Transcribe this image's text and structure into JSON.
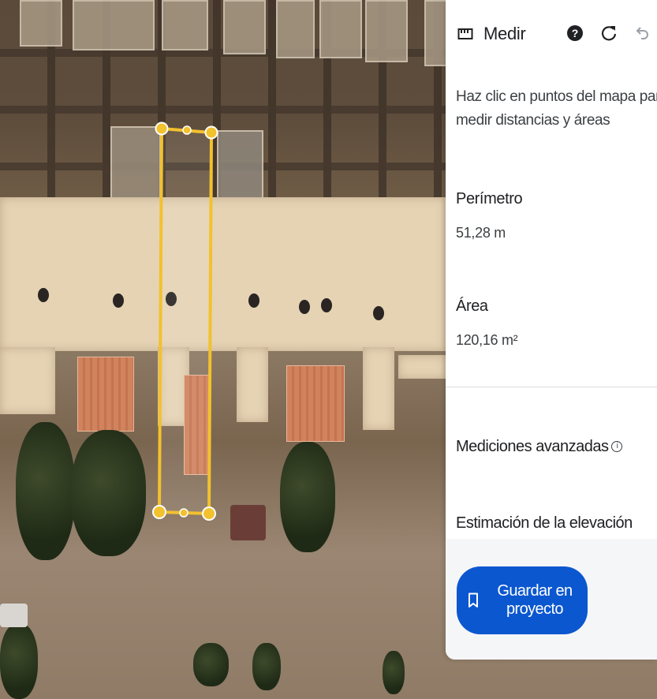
{
  "panel": {
    "title": "Medir",
    "instructions": "Haz clic en puntos del mapa para medir distancias y áreas",
    "perimeter_label": "Perímetro",
    "perimeter_value": "51,28 m",
    "area_label": "Área",
    "area_value": "120,16 m²",
    "advanced_label": "Mediciones avanzadas",
    "elevation_label": "Estimación de la elevación",
    "save_label": "Guardar en proyecto"
  },
  "icons": {
    "ruler": "ruler-icon",
    "help": "help-icon",
    "refresh": "refresh-icon",
    "undo": "undo-icon",
    "info": "info-icon",
    "bookmark": "bookmark-icon"
  },
  "colors": {
    "accent": "#0b57d0",
    "measure_line": "#f2c12e",
    "panel_bg": "#ffffff"
  }
}
